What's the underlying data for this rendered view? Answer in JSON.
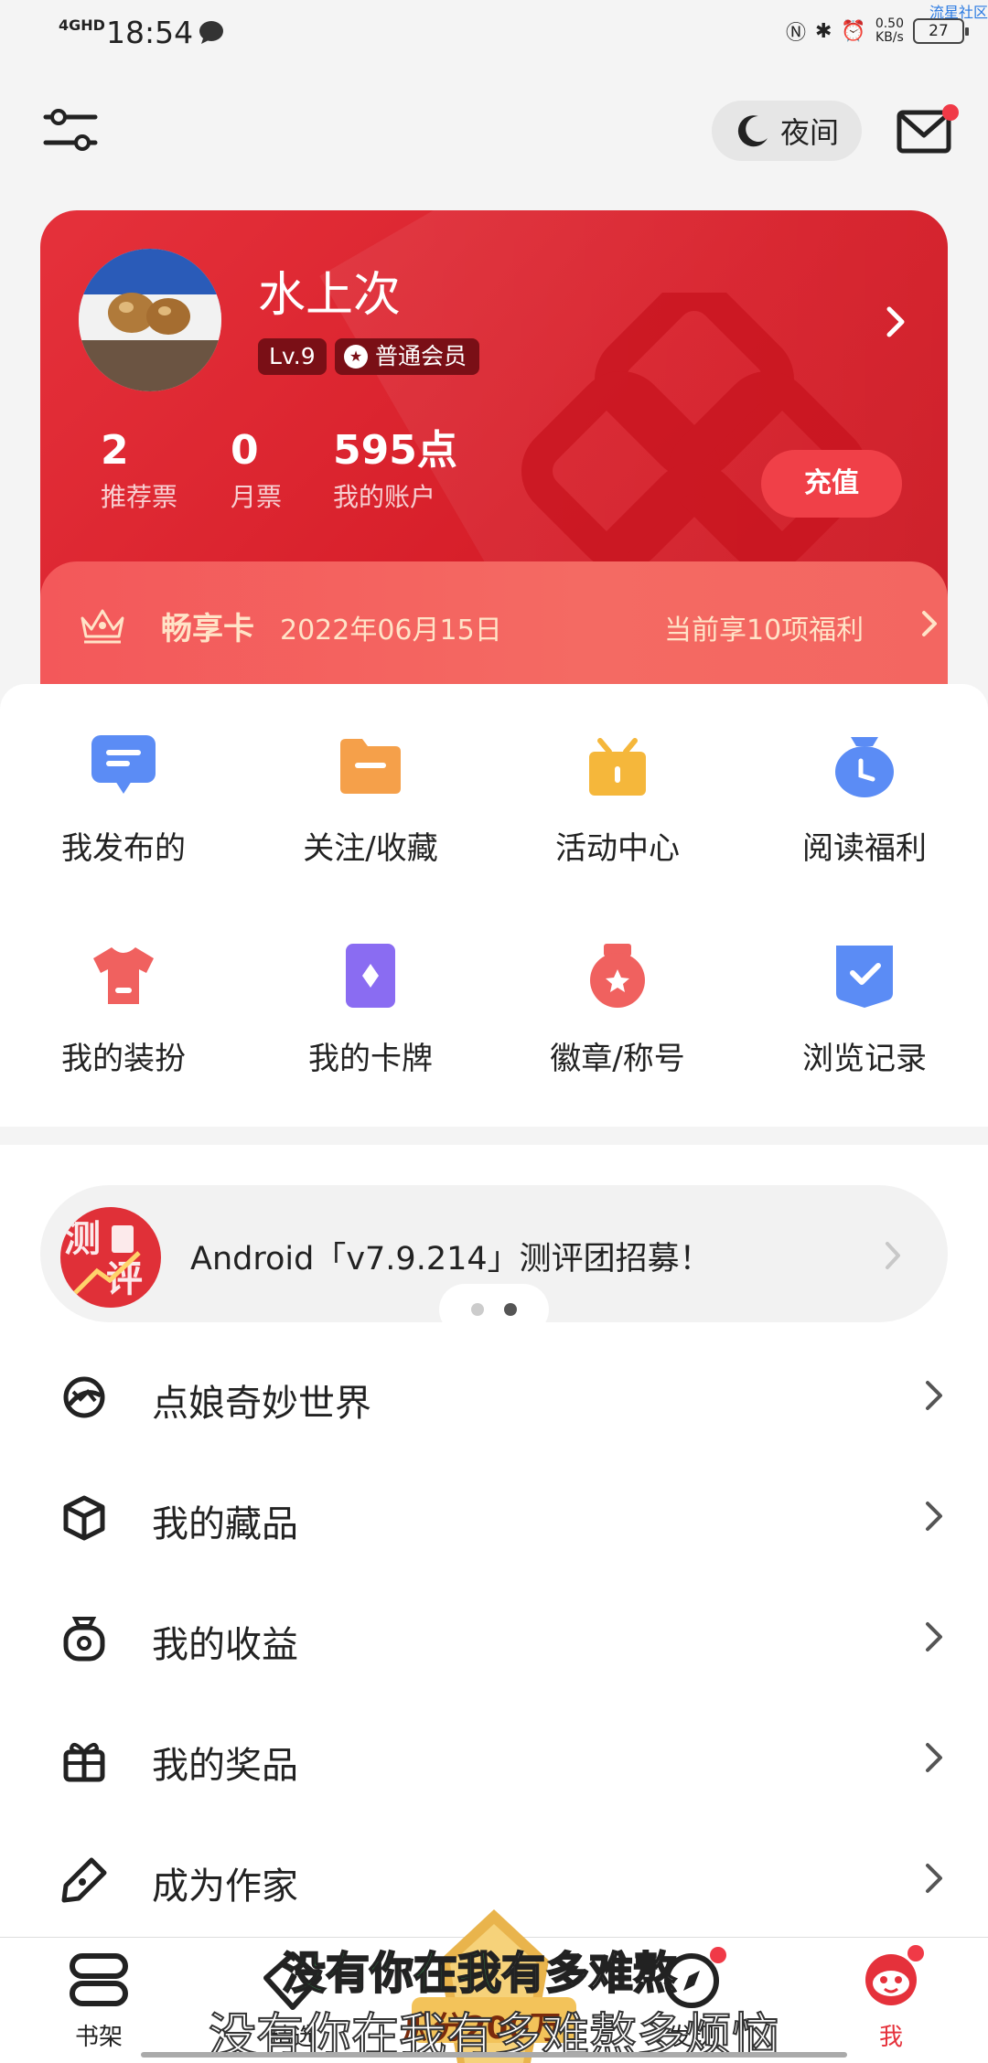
{
  "status_bar": {
    "network": "4GHD",
    "time": "18:54",
    "speed_value": "0.50",
    "speed_unit": "KB/s",
    "battery": "27",
    "corner_text": "流星社区"
  },
  "header": {
    "night_label": "夜间"
  },
  "profile": {
    "username": "水上次",
    "level": "Lv.9",
    "member": "普通会员",
    "stats": [
      {
        "value": "2",
        "label": "推荐票"
      },
      {
        "value": "0",
        "label": "月票"
      },
      {
        "value": "595点",
        "label": "我的账户"
      }
    ],
    "recharge_label": "充值"
  },
  "vip": {
    "name": "畅享卡",
    "date": "2022年06月15日",
    "benefit": "当前享10项福利"
  },
  "grid": [
    {
      "label": "我发布的",
      "icon": "message-icon",
      "color": "#5b8cf5"
    },
    {
      "label": "关注/收藏",
      "icon": "folder-icon",
      "color": "#f5a04a"
    },
    {
      "label": "活动中心",
      "icon": "gift-box-icon",
      "color": "#f5b73b"
    },
    {
      "label": "阅读福利",
      "icon": "clock-bag-icon",
      "color": "#5b8cf5"
    },
    {
      "label": "我的装扮",
      "icon": "shirt-icon",
      "color": "#f0615f"
    },
    {
      "label": "我的卡牌",
      "icon": "card-icon",
      "color": "#8a6cf2"
    },
    {
      "label": "徽章/称号",
      "icon": "medal-icon",
      "color": "#f0615f"
    },
    {
      "label": "浏览记录",
      "icon": "history-shield-icon",
      "color": "#5b8cf5"
    }
  ],
  "banner": {
    "icon_text": "测评",
    "text": "Android「v7.9.214」测评团招募！"
  },
  "menu": [
    {
      "label": "点娘奇妙世界",
      "icon": "world-icon"
    },
    {
      "label": "我的藏品",
      "icon": "cube-icon"
    },
    {
      "label": "我的收益",
      "icon": "money-bag-icon"
    },
    {
      "label": "我的奖品",
      "icon": "gift-icon"
    },
    {
      "label": "成为作家",
      "icon": "pen-icon"
    }
  ],
  "bottom_nav": [
    {
      "label": "书架",
      "icon": "bookshelf-icon"
    },
    {
      "label": "精选",
      "icon": "diamond-icon"
    },
    {
      "label": "发现",
      "icon": "compass-icon"
    },
    {
      "label": "我",
      "icon": "mascot-icon"
    }
  ],
  "promo": {
    "text": "瓜分200万"
  },
  "subtitles": {
    "line1_highlight": "没有你在我",
    "line1_rest": "有多难熬",
    "line2": "没有你在我有多难熬多烦恼"
  }
}
